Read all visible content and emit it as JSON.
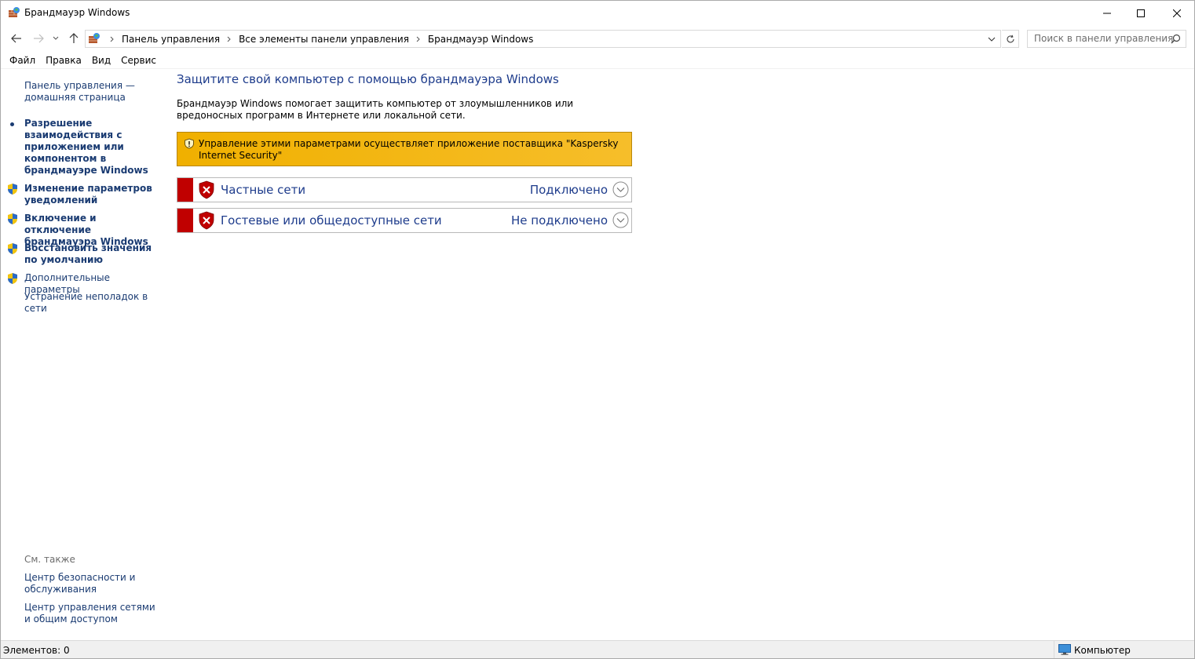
{
  "window": {
    "title": "Брандмауэр Windows",
    "icons": {
      "app": "firewall-icon",
      "minimize": "minimize-icon",
      "maximize": "maximize-icon",
      "close": "close-icon"
    }
  },
  "navigation": {
    "icons": {
      "back": "arrow-left-icon",
      "forward": "arrow-right-icon",
      "recent": "chevron-down-icon",
      "up": "arrow-up-icon"
    },
    "breadcrumbs": [
      "Панель управления",
      "Все элементы панели управления",
      "Брандмауэр Windows"
    ],
    "search_placeholder": "Поиск в панели управления"
  },
  "menu": {
    "items": [
      "Файл",
      "Правка",
      "Вид",
      "Сервис"
    ]
  },
  "sidebar": {
    "home_link": "Панель управления — домашняя страница",
    "tasks": [
      {
        "label": "Разрешение взаимодействия с приложением или компонентом в брандмауэре Windows",
        "icon": "bullet"
      },
      {
        "label": "Изменение параметров уведомлений",
        "icon": "uac-shield-icon"
      },
      {
        "label": "Включение и отключение брандмауэра Windows",
        "icon": "uac-shield-icon"
      },
      {
        "label": "Восстановить значения по умолчанию",
        "icon": "uac-shield-icon"
      },
      {
        "label": "Дополнительные параметры",
        "icon": "uac-shield-icon"
      },
      {
        "label": "Устранение неполадок в сети",
        "icon": "none"
      }
    ],
    "see_also": {
      "heading": "См. также",
      "links": [
        "Центр безопасности и обслуживания",
        "Центр управления сетями и общим доступом"
      ]
    }
  },
  "main": {
    "heading": "Защитите свой компьютер с помощью брандмауэра Windows",
    "description": "Брандмауэр Windows помогает защитить компьютер от злоумышленников или вредоносных программ в Интернете или локальной сети.",
    "warning": {
      "text": "Управление этими параметрами осуществляет приложение поставщика \"Kaspersky Internet Security\"",
      "icon": "warning-shield-icon",
      "color": "#f0b000"
    },
    "networks": [
      {
        "name": "Частные сети",
        "status": "Подключено",
        "state_color": "#c00000"
      },
      {
        "name": "Гостевые или общедоступные сети",
        "status": "Не подключено",
        "state_color": "#c00000"
      }
    ]
  },
  "statusbar": {
    "items_count": "Элементов: 0",
    "location": "Компьютер"
  },
  "colors": {
    "link": "#1a3b72",
    "heading": "#1e3c8c",
    "danger": "#c00000"
  }
}
